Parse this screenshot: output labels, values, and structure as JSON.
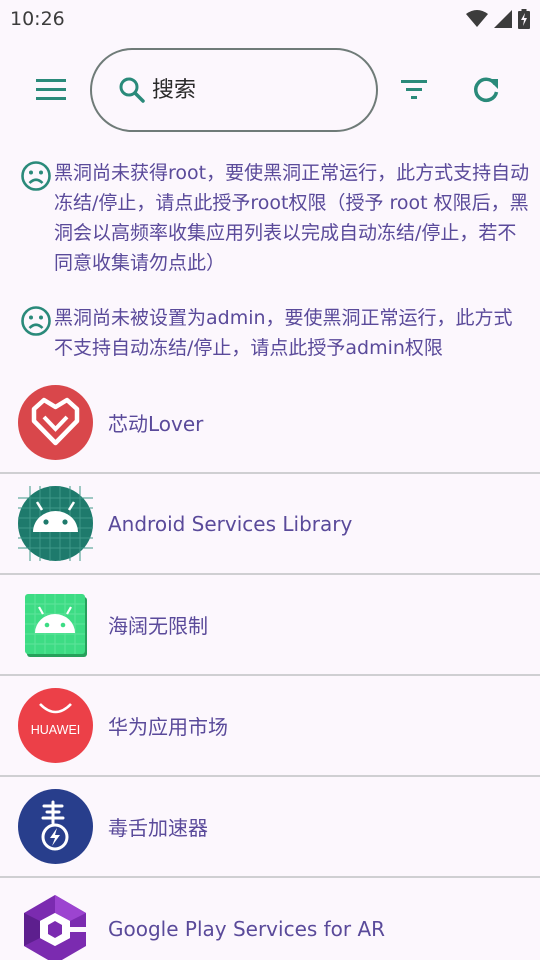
{
  "status_bar": {
    "time": "10:26"
  },
  "toolbar": {
    "search_placeholder": "搜索",
    "icons": {
      "menu": "menu-icon",
      "search": "search-icon",
      "filter": "filter-icon",
      "refresh": "refresh-icon"
    }
  },
  "notices": [
    {
      "icon": "sad-face-icon",
      "text": "黑洞尚未获得root，要使黑洞正常运行，此方式支持自动冻结/停止，请点此授予root权限（授予 root 权限后，黑洞会以高频率收集应用列表以完成自动冻结/停止，若不同意收集请勿点此）"
    },
    {
      "icon": "sad-face-icon",
      "text": "黑洞尚未被设置为admin，要使黑洞正常运行，此方式不支持自动冻结/停止，请点此授予admin权限"
    }
  ],
  "apps": [
    {
      "name": "芯动Lover",
      "icon": "heart-app-icon"
    },
    {
      "name": "Android Services Library",
      "icon": "android-icon"
    },
    {
      "name": "海阔无限制",
      "icon": "android-icon"
    },
    {
      "name": "华为应用市场",
      "icon": "huawei-icon",
      "icon_text": "HUAWEI"
    },
    {
      "name": "毒舌加速器",
      "icon": "accelerator-icon"
    },
    {
      "name": "Google Play Services for AR",
      "icon": "arcore-icon"
    }
  ],
  "colors": {
    "accent": "#2a8a7a",
    "text": "#5a4a9a",
    "background": "#fcf7fd"
  }
}
